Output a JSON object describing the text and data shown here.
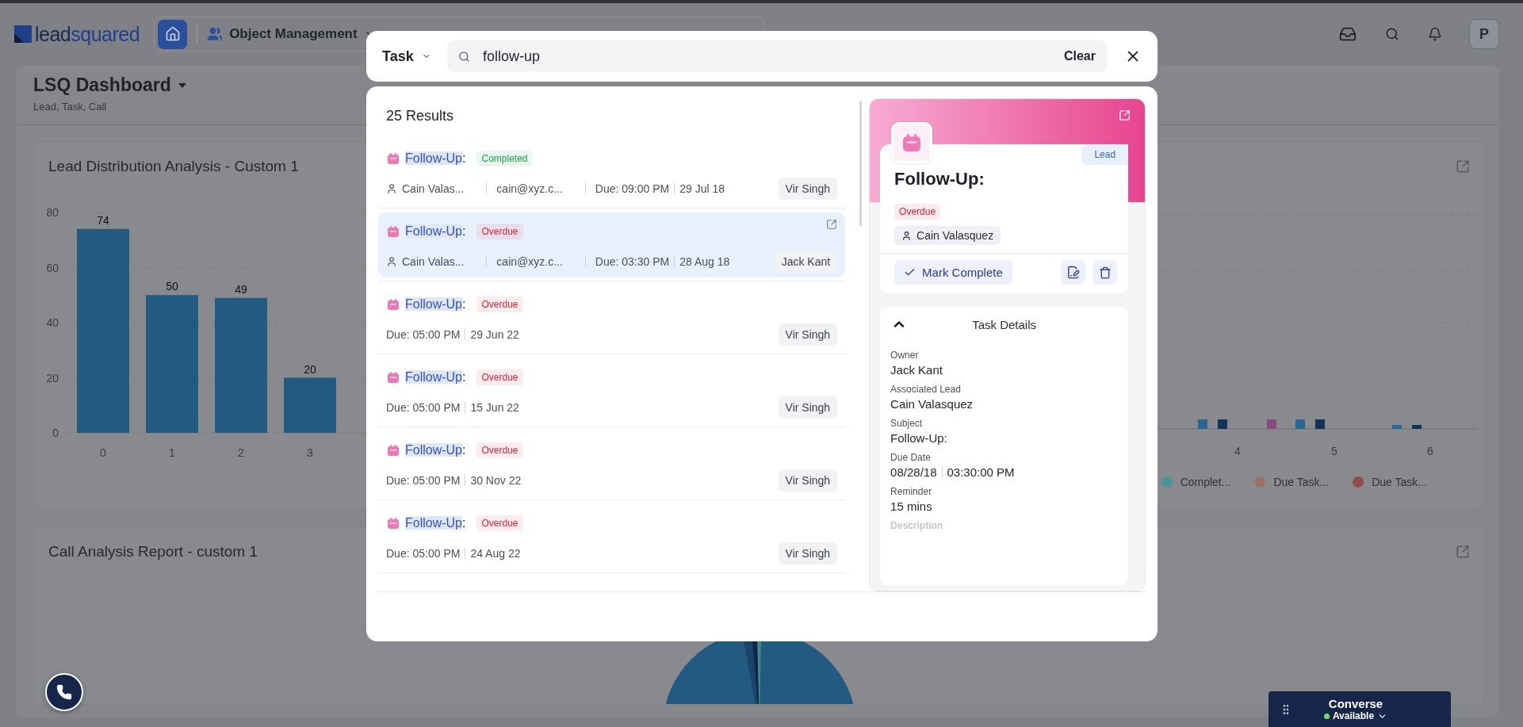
{
  "header": {
    "logo_prefix": "lead",
    "logo_suffix": "squared",
    "module": "Object Management",
    "avatar": "P"
  },
  "dashboard": {
    "title": "LSQ Dashboard",
    "subtitle": "Lead, Task, Call"
  },
  "lead_distribution_card": {
    "title": "Lead Distribution Analysis - Custom 1",
    "chart_data": {
      "type": "bar",
      "categories": [
        "0",
        "1",
        "2",
        "3"
      ],
      "values": [
        74,
        50,
        49,
        20
      ],
      "ylim": [
        0,
        80
      ],
      "grid": true,
      "yticks": [
        0,
        20,
        40,
        60,
        80
      ],
      "data_labels": true
    }
  },
  "task_chart_card": {
    "x_labels": [
      "4",
      "5",
      "6"
    ],
    "legend": [
      {
        "label": "Complet...",
        "color": "#4a9696"
      },
      {
        "label": "Due Task...",
        "color": "#9a7268"
      },
      {
        "label": "Due Task...",
        "color": "#944c4a"
      }
    ]
  },
  "call_analysis_card": {
    "title": "Call Analysis Report - custom 1"
  },
  "search_modal": {
    "object_type": "Task",
    "query": "follow-up",
    "clear_label": "Clear",
    "results_count": "25 Results",
    "results": [
      {
        "match": "Follow-Up",
        "rest": ":",
        "status": "Completed",
        "color": "#1f9d4c",
        "lead": "Cain Valas...",
        "email": "cain@xyz.c...",
        "due_time": "Due: 09:00 PM",
        "due_date": "29 Jul 18",
        "owner": "Vir Singh",
        "selected": false
      },
      {
        "match": "Follow-Up",
        "rest": ":",
        "status": "Overdue",
        "color": "#e0243a",
        "lead": "Cain Valas...",
        "email": "cain@xyz.c...",
        "due_time": "Due: 03:30 PM",
        "due_date": "28 Aug 18",
        "owner": "Jack Kant",
        "selected": true
      },
      {
        "match": "Follow-Up",
        "rest": ":",
        "status": "Overdue",
        "color": "#e0243a",
        "due_time": "Due: 05:00 PM",
        "due_date": "29 Jun 22",
        "owner": "Vir Singh",
        "selected": false
      },
      {
        "match": "Follow-Up",
        "rest": ":",
        "status": "Overdue",
        "color": "#e0243a",
        "due_time": "Due: 05:00 PM",
        "due_date": "15 Jun 22",
        "owner": "Vir Singh",
        "selected": false
      },
      {
        "match": "Follow-Up",
        "rest": ":",
        "status": "Overdue",
        "color": "#e0243a",
        "due_time": "Due: 05:00 PM",
        "due_date": "30 Nov 22",
        "owner": "Vir Singh",
        "selected": false
      },
      {
        "match": "Follow-Up",
        "rest": ":",
        "status": "Overdue",
        "color": "#e0243a",
        "due_time": "Due: 05:00 PM",
        "due_date": "24 Aug 22",
        "owner": "Vir Singh",
        "selected": false
      }
    ],
    "detail": {
      "tag": "Lead",
      "title": "Follow-Up:",
      "status": "Overdue",
      "color": "#e0243a",
      "lead": "Cain Valasquez",
      "mark_complete": "Mark Complete",
      "section": {
        "title": "Task Details",
        "expanded": true,
        "fields": [
          {
            "label": "Owner",
            "value": "Jack Kant"
          },
          {
            "label": "Associated Lead",
            "value": "Cain Valasquez"
          },
          {
            "label": "Subject",
            "value": "Follow-Up:"
          },
          {
            "label": "Due Date",
            "value": "08/28/18",
            "value_2": "03:30:00 PM"
          },
          {
            "label": "Reminder",
            "value": "15 mins"
          },
          {
            "label": "Description"
          }
        ]
      }
    }
  },
  "converse": {
    "title": "Converse",
    "status": "Available",
    "online": true
  }
}
